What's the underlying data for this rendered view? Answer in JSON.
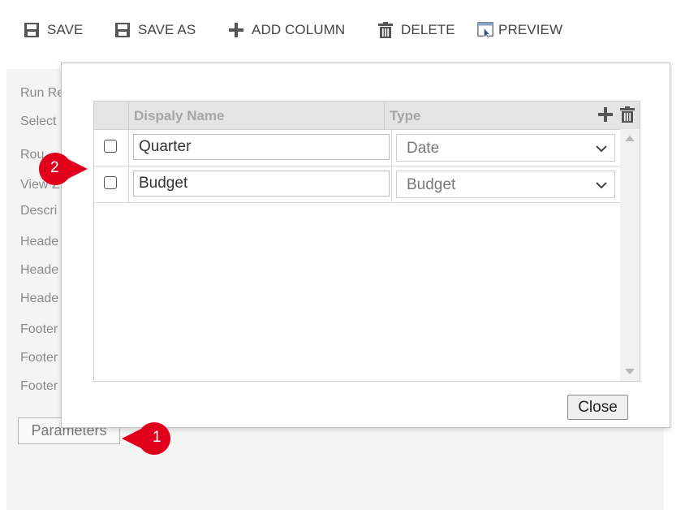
{
  "toolbar": {
    "save_label": "SAVE",
    "save_as_label": "SAVE AS",
    "add_column_label": "ADD COLUMN",
    "delete_label": "DELETE",
    "preview_label": "PREVIEW"
  },
  "background_form": {
    "labels": [
      "Run Re",
      "Select",
      "Rou",
      "View Z",
      "Descri",
      "Heade",
      "Heade",
      "Heade",
      "Footer",
      "Footer",
      "Footer"
    ],
    "parameters_button_label": "Parameters"
  },
  "dialog": {
    "columns_header": {
      "display_name": "Dispaly Name",
      "type": "Type"
    },
    "rows": [
      {
        "checked": false,
        "display_name": "Quarter",
        "type": "Date"
      },
      {
        "checked": false,
        "display_name": "Budget",
        "type": "Budget"
      }
    ],
    "close_label": "Close"
  },
  "callouts": [
    {
      "number": "1",
      "color": "#e0001b"
    },
    {
      "number": "2",
      "color": "#e0001b"
    }
  ]
}
